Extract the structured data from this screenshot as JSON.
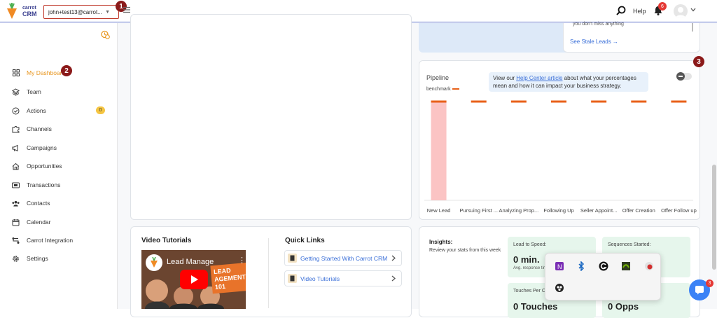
{
  "header": {
    "logo_line1": "carrot",
    "logo_line2": "CRM",
    "account_email": "john+test13@carrot...",
    "help_label": "Help",
    "notif_count": "6"
  },
  "markers": [
    "1",
    "2",
    "3"
  ],
  "sidebar": {
    "items": [
      {
        "label": "My Dashboard",
        "icon": "dashboard-icon",
        "active": true
      },
      {
        "label": "Team",
        "icon": "layers-icon"
      },
      {
        "label": "Actions",
        "icon": "check-circle-icon",
        "badge": "0"
      },
      {
        "label": "Channels",
        "icon": "puzzle-icon"
      },
      {
        "label": "Campaigns",
        "icon": "megaphone-icon"
      },
      {
        "label": "Opportunities",
        "icon": "home-icon"
      },
      {
        "label": "Transactions",
        "icon": "transactions-icon"
      },
      {
        "label": "Contacts",
        "icon": "contacts-icon"
      },
      {
        "label": "Calendar",
        "icon": "calendar-icon"
      },
      {
        "label": "Carrot Integration",
        "icon": "integration-icon"
      },
      {
        "label": "Settings",
        "icon": "gear-icon"
      }
    ]
  },
  "stale": {
    "text": "you don't miss anything",
    "link": "See Stale Leads →"
  },
  "pipeline": {
    "title": "Pipeline",
    "benchmark_label": "benchmark",
    "tip_before": "View our ",
    "tip_link": "Help Center article",
    "tip_after": " about what your percentages mean and how it can impact your business strategy."
  },
  "chart_data": {
    "type": "bar",
    "categories": [
      "New Lead",
      "Pursuing First ...",
      "Analyzing Prop...",
      "Following Up",
      "Seller Appoint...",
      "Offer Creation",
      "Offer Follow up"
    ],
    "values": [
      100,
      0,
      0,
      0,
      0,
      0,
      0
    ],
    "benchmark": [
      100,
      100,
      100,
      100,
      100,
      100,
      100
    ],
    "ylim": [
      0,
      100
    ],
    "colors": {
      "bar": "#fbc4c4",
      "benchmark": "#e8611a"
    }
  },
  "insights": {
    "title": "Insights:",
    "subtitle": "Review your stats from this week",
    "stats": [
      {
        "label": "Lead to Speed:",
        "value": "0 min.",
        "sub": "Avg. response tim"
      },
      {
        "label": "Sequences Started:",
        "value": "",
        "sub": ""
      },
      {
        "label": "Touches Per C",
        "value": "0 Touches",
        "sub": ""
      },
      {
        "label": "",
        "value": "0 Opps",
        "sub": ""
      }
    ]
  },
  "video_tutorials": {
    "title": "Video Tutorials",
    "video_title": "Lead Manage",
    "banner": "LEAD AGEMENT 101"
  },
  "quick_links": {
    "title": "Quick Links",
    "items": [
      "Getting Started With Carrot CRM",
      "Video Tutorials"
    ]
  },
  "chat": {
    "badge": "3"
  }
}
